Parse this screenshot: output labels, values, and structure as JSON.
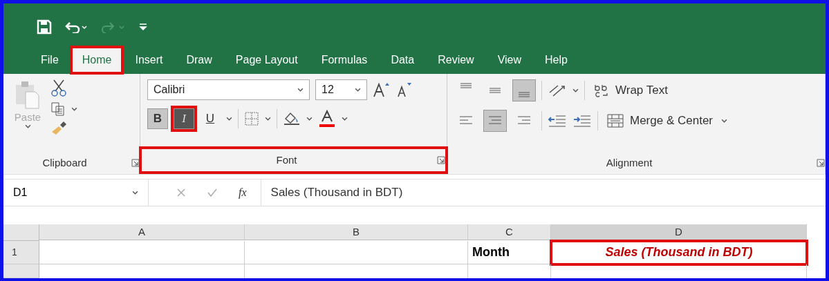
{
  "tabs": [
    {
      "label": "File",
      "selected": false,
      "highlighted": false
    },
    {
      "label": "Home",
      "selected": true,
      "highlighted": true
    },
    {
      "label": "Insert",
      "selected": false,
      "highlighted": false
    },
    {
      "label": "Draw",
      "selected": false,
      "highlighted": false
    },
    {
      "label": "Page Layout",
      "selected": false,
      "highlighted": false
    },
    {
      "label": "Formulas",
      "selected": false,
      "highlighted": false
    },
    {
      "label": "Data",
      "selected": false,
      "highlighted": false
    },
    {
      "label": "Review",
      "selected": false,
      "highlighted": false
    },
    {
      "label": "View",
      "selected": false,
      "highlighted": false
    },
    {
      "label": "Help",
      "selected": false,
      "highlighted": false
    }
  ],
  "clipboard": {
    "paste_label": "Paste",
    "label": "Clipboard"
  },
  "font": {
    "label": "Font",
    "highlighted": true,
    "font_name": "Calibri",
    "font_size": "12",
    "styles": [
      {
        "kind": "bold",
        "label": "B",
        "selected": true,
        "highlighted": false
      },
      {
        "kind": "italic",
        "label": "I",
        "selected": true,
        "highlighted": true
      },
      {
        "kind": "underline",
        "label": "U",
        "selected": false,
        "highlighted": false
      }
    ]
  },
  "alignment": {
    "label": "Alignment",
    "wrap_text": "Wrap Text",
    "merge": "Merge & Center",
    "vertical": [
      {
        "kind": "top",
        "selected": false
      },
      {
        "kind": "middle",
        "selected": false
      },
      {
        "kind": "bottom",
        "selected": true
      }
    ],
    "horizontal": [
      {
        "kind": "left",
        "selected": false
      },
      {
        "kind": "center",
        "selected": true
      },
      {
        "kind": "right",
        "selected": false
      }
    ]
  },
  "formula_bar": {
    "name_box": "D1",
    "fx": "fx",
    "value": "Sales (Thousand in BDT)"
  },
  "columns": [
    {
      "label": "A",
      "selected": false
    },
    {
      "label": "B",
      "selected": false
    },
    {
      "label": "C",
      "selected": false
    },
    {
      "label": "D",
      "selected": true
    }
  ],
  "rows": [
    {
      "number": "1",
      "cells": [
        {
          "selected": false
        },
        {
          "selected": false
        },
        {
          "text": "Month",
          "selected": false
        },
        {
          "text": "Sales (Thousand in BDT)",
          "selected": true,
          "highlighted": true
        }
      ]
    }
  ]
}
